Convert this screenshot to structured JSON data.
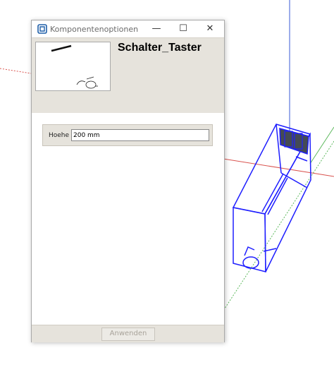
{
  "dialog": {
    "title": "Komponentenoptionen",
    "window_controls": {
      "minimize": "—",
      "maximize": "☐",
      "close": "✕"
    },
    "component_name": "Schalter_Taster",
    "fields": [
      {
        "label": "Hoehe",
        "value": "200 mm"
      }
    ],
    "apply_label": "Anwenden"
  },
  "colors": {
    "model_edges": "#1f1fff",
    "panel_bg": "#e6e3dc",
    "axis_red": "#d9534f",
    "axis_green": "#5cb85c"
  },
  "icons": [
    "sketchup-icon",
    "component-thumbnail",
    "schalter-model"
  ]
}
